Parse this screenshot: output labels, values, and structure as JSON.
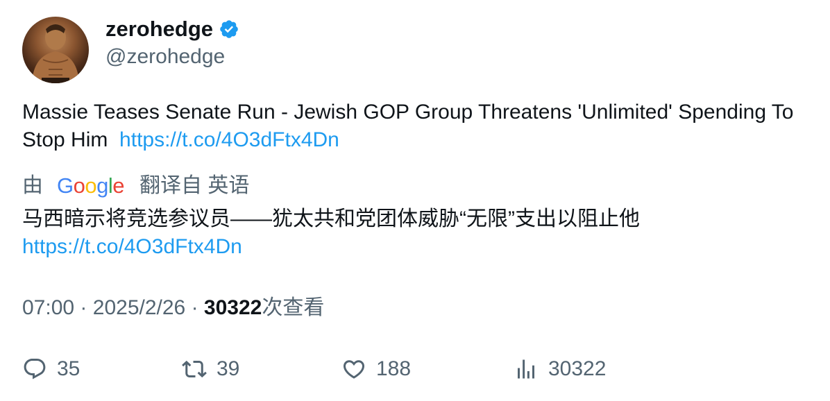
{
  "author": {
    "display_name": "zerohedge",
    "handle": "@zerohedge",
    "avatar_icon": "profile-photo",
    "verified_icon": "verified-badge-icon",
    "verified_color": "#1d9bf0"
  },
  "tweet": {
    "text": "Massie Teases Senate Run - Jewish GOP Group Threatens 'Unlimited' Spending To Stop Him",
    "link": "https://t.co/4O3dFtx4Dn"
  },
  "translation": {
    "prefix": "由",
    "provider": "Google",
    "suffix": "翻译自 英语",
    "text": "马西暗示将竞选参议员——犹太共和党团体威胁“无限”支出以阻止他",
    "link": "https://t.co/4O3dFtx4Dn"
  },
  "meta": {
    "time": "07:00",
    "date": "2025/2/26",
    "separator": "·",
    "views_count": "30322",
    "views_label": "次查看"
  },
  "actions": {
    "replies": "35",
    "retweets": "39",
    "likes": "188",
    "views": "30322"
  },
  "colors": {
    "text": "#0f1419",
    "secondary": "#536471",
    "link": "#1d9bf0"
  }
}
